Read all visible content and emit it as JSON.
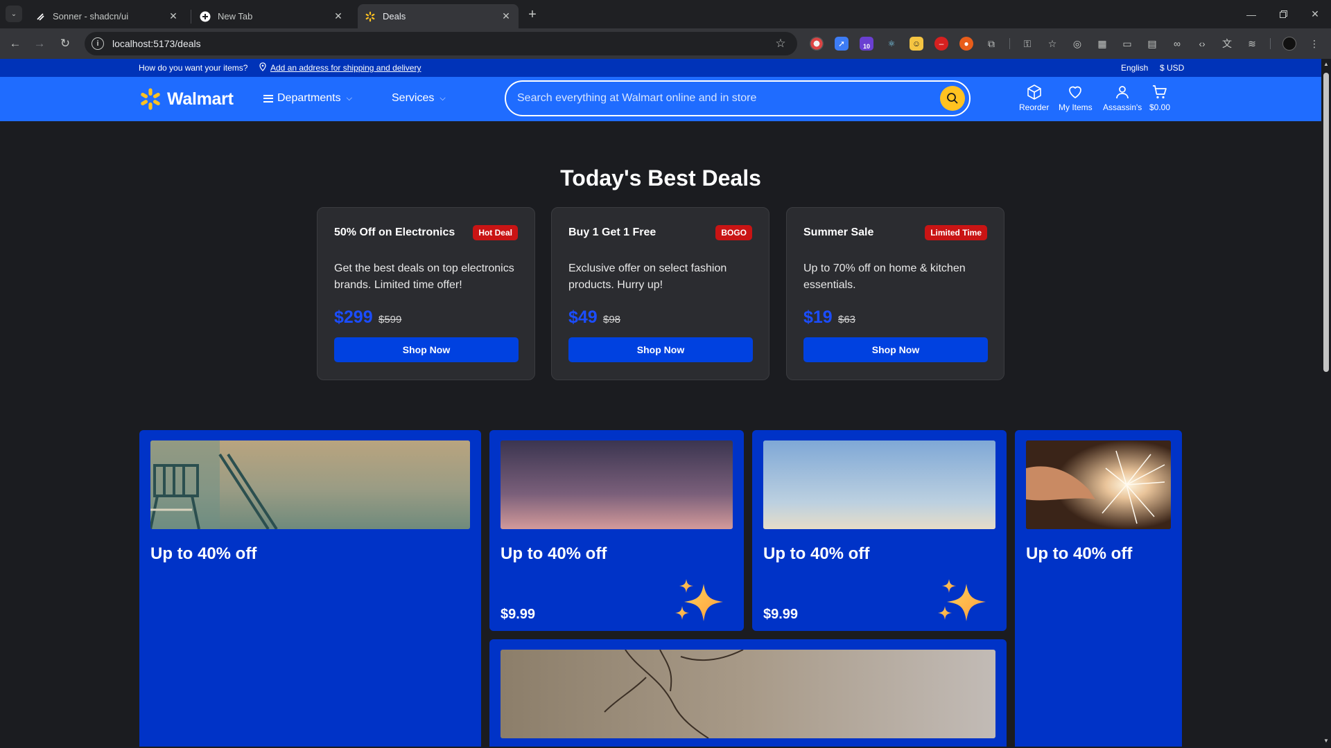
{
  "browser": {
    "tabs": [
      {
        "title": "Sonner - shadcn/ui",
        "icon": "shadcn-icon"
      },
      {
        "title": "New Tab",
        "icon": "chrome-icon"
      },
      {
        "title": "Deals",
        "icon": "walmart-spark-icon"
      }
    ],
    "url": "localhost:5173/deals",
    "extension_badge": "10"
  },
  "topstrip": {
    "question": "How do you want your items?",
    "address_link": "Add an address for shipping and delivery",
    "language": "English",
    "currency": "$ USD"
  },
  "header": {
    "brand": "Walmart",
    "nav": [
      {
        "label": "Departments"
      },
      {
        "label": "Services"
      }
    ],
    "search_placeholder": "Search everything at Walmart online and in store",
    "actions": [
      {
        "label": "Reorder",
        "icon": "box-icon"
      },
      {
        "label": "My Items",
        "icon": "heart-icon"
      },
      {
        "label": "Assassin's",
        "icon": "user-icon"
      },
      {
        "label": "$0.00",
        "icon": "cart-icon"
      }
    ],
    "colors": {
      "bar": "#1f6cff",
      "strip": "#0033b8",
      "search_button": "#ffc220"
    }
  },
  "page": {
    "title": "Today's Best Deals"
  },
  "deals": [
    {
      "title": "50% Off on Electronics",
      "badge": "Hot Deal",
      "description": "Get the best deals on top electronics brands. Limited time offer!",
      "price": "$299",
      "original_price": "$599",
      "button": "Shop Now"
    },
    {
      "title": "Buy 1 Get 1 Free",
      "badge": "BOGO",
      "description": "Exclusive offer on select fashion products. Hurry up!",
      "price": "$49",
      "original_price": "$98",
      "button": "Shop Now"
    },
    {
      "title": "Summer Sale",
      "badge": "Limited Time",
      "description": "Up to 70% off on home & kitchen essentials.",
      "price": "$19",
      "original_price": "$63",
      "button": "Shop Now"
    }
  ],
  "promos": [
    {
      "title": "Up to 40% off",
      "image": "lifeguard-tower-photo"
    },
    {
      "title": "Up to 40% off",
      "price": "$9.99",
      "image": "dusk-sky-photo",
      "icon": "sparkles-icon"
    },
    {
      "title": "Up to 40% off",
      "price": "$9.99",
      "image": "clear-sky-photo",
      "icon": "sparkles-icon"
    },
    {
      "title": "Up to 40% off",
      "image": "sparkler-photo"
    },
    {
      "image": "tree-branches-photo"
    }
  ]
}
